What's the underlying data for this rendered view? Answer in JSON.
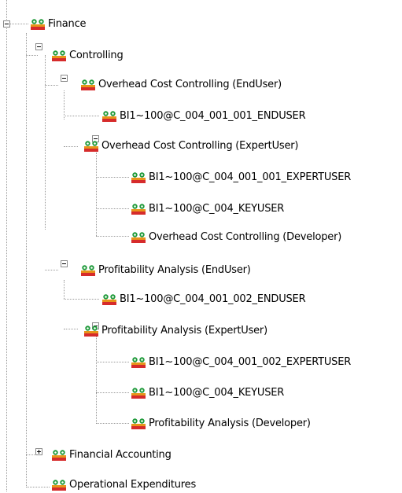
{
  "tree": {
    "nodes": [
      {
        "key": "finance",
        "label": "Finance",
        "icon": "user-group-icon",
        "toggle": "expanded"
      },
      {
        "key": "controlling",
        "label": "Controlling",
        "icon": "user-group-icon",
        "toggle": "expanded"
      },
      {
        "key": "occ-enduser",
        "label": "Overhead Cost Controlling (EndUser)",
        "icon": "user-group-icon",
        "toggle": "expanded"
      },
      {
        "key": "occ-enduser-role",
        "label": "BI1~100@C_004_001_001_ENDUSER",
        "icon": "user-group-icon",
        "toggle": "none"
      },
      {
        "key": "occ-expertuser",
        "label": "Overhead Cost Controlling (ExpertUser)",
        "icon": "user-group-icon",
        "toggle": "expanded"
      },
      {
        "key": "occ-expertuser-role",
        "label": "BI1~100@C_004_001_001_EXPERTUSER",
        "icon": "user-group-icon",
        "toggle": "none"
      },
      {
        "key": "occ-keyuser-role",
        "label": "BI1~100@C_004_KEYUSER",
        "icon": "user-group-icon",
        "toggle": "none"
      },
      {
        "key": "occ-developer",
        "label": "Overhead Cost Controlling (Developer)",
        "icon": "user-group-icon",
        "toggle": "none"
      },
      {
        "key": "pa-enduser",
        "label": "Profitability Analysis (EndUser)",
        "icon": "user-group-icon",
        "toggle": "expanded"
      },
      {
        "key": "pa-enduser-role",
        "label": "BI1~100@C_004_001_002_ENDUSER",
        "icon": "user-group-icon",
        "toggle": "none"
      },
      {
        "key": "pa-expertuser",
        "label": "Profitability Analysis (ExpertUser)",
        "icon": "user-group-icon",
        "toggle": "expanded"
      },
      {
        "key": "pa-expertuser-role",
        "label": "BI1~100@C_004_001_002_EXPERTUSER",
        "icon": "user-group-icon",
        "toggle": "none"
      },
      {
        "key": "pa-keyuser-role",
        "label": "BI1~100@C_004_KEYUSER",
        "icon": "user-group-icon",
        "toggle": "none"
      },
      {
        "key": "pa-developer",
        "label": "Profitability Analysis (Developer)",
        "icon": "user-group-icon",
        "toggle": "none"
      },
      {
        "key": "financial-accounting",
        "label": "Financial Accounting",
        "icon": "user-group-icon",
        "toggle": "collapsed"
      },
      {
        "key": "operational-expenditures",
        "label": "Operational Expenditures",
        "icon": "user-group-icon",
        "toggle": "none"
      }
    ]
  },
  "colors": {
    "tree_line": "#9a9a9a",
    "icon_green": "#1f9a3a",
    "icon_orange": "#e8941a",
    "icon_red": "#d62b2b"
  }
}
